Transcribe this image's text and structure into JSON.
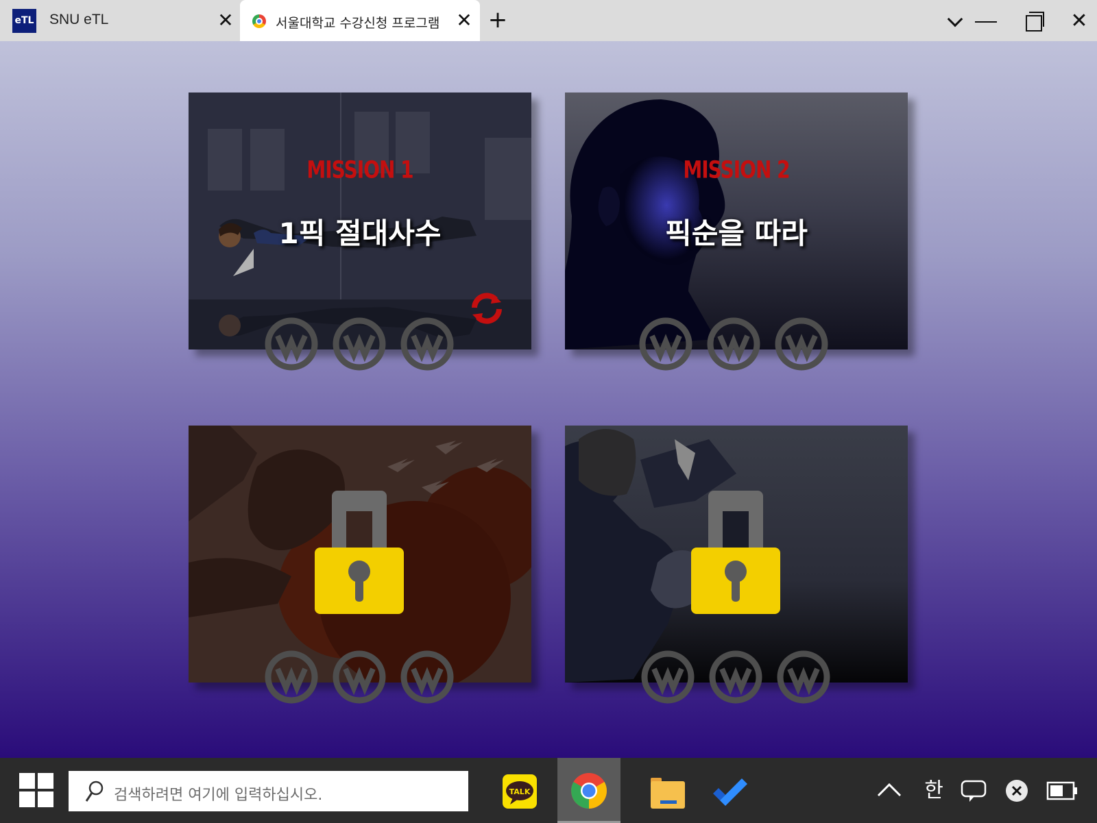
{
  "tabs": [
    {
      "title": "SNU eTL",
      "icon": "etl-icon",
      "icon_text": "eTL",
      "active": false
    },
    {
      "title": "서울대학교 수강신청 프로그램",
      "icon": "chrome-icon",
      "active": true
    }
  ],
  "missions": [
    {
      "label": "MISSION 1",
      "title": "1픽 절대사수",
      "locked": false
    },
    {
      "label": "MISSION 2",
      "title": "픽순을 따라",
      "locked": false
    },
    {
      "locked": true
    },
    {
      "locked": true
    }
  ],
  "taskbar": {
    "search_placeholder": "검색하려면 여기에 입력하십시오.",
    "kakao_label": "TALK",
    "ime": "한"
  },
  "colors": {
    "mission_red": "#c40f0f",
    "lock_yellow": "#f3cf00",
    "taskbar": "#2b2b2b"
  }
}
